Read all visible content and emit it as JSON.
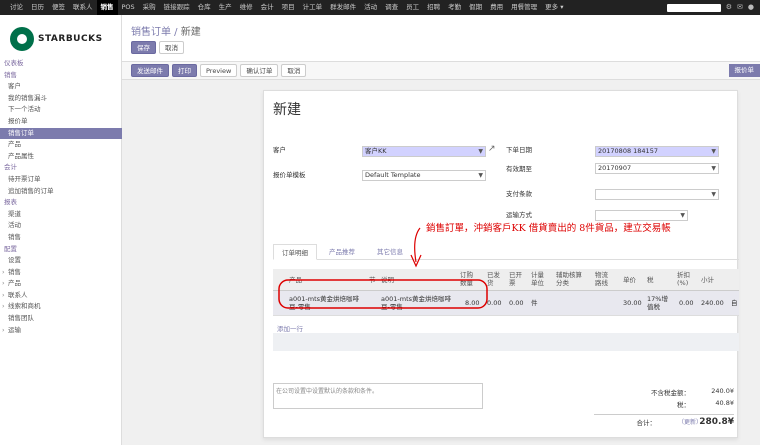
{
  "topbar": {
    "menu": [
      "讨论",
      "日历",
      "便签",
      "联系人",
      "销售",
      "POS",
      "采购",
      "链接跟踪",
      "仓库",
      "生产",
      "维修",
      "会计",
      "项目",
      "计工单",
      "群发邮件",
      "活动",
      "调查",
      "员工",
      "招聘",
      "考勤",
      "假期",
      "费用",
      "用餐管理",
      "更多 ▾"
    ],
    "active_index": 4
  },
  "logo": {
    "text": "STARBUCKS",
    "mark": "starbucks-logo"
  },
  "sidebar": {
    "items": [
      {
        "label": "仪表板",
        "kind": "head"
      },
      {
        "label": "销售",
        "kind": "head"
      },
      {
        "label": "客户",
        "kind": "sub"
      },
      {
        "label": "我的销售漏斗",
        "kind": "sub"
      },
      {
        "label": "下一个活动",
        "kind": "sub"
      },
      {
        "label": "报价单",
        "kind": "sub"
      },
      {
        "label": "销售订单",
        "kind": "active"
      },
      {
        "label": "产品",
        "kind": "sub"
      },
      {
        "label": "产品属性",
        "kind": "sub"
      },
      {
        "label": "会计",
        "kind": "head"
      },
      {
        "label": "待开票订单",
        "kind": "sub"
      },
      {
        "label": "追加销售的订单",
        "kind": "sub"
      },
      {
        "label": "报表",
        "kind": "head"
      },
      {
        "label": "渠道",
        "kind": "sub"
      },
      {
        "label": "活动",
        "kind": "sub"
      },
      {
        "label": "销售",
        "kind": "sub"
      },
      {
        "label": "配置",
        "kind": "head"
      },
      {
        "label": "设置",
        "kind": "sub"
      },
      {
        "label": "销售",
        "kind": "caret"
      },
      {
        "label": "产品",
        "kind": "caret"
      },
      {
        "label": "联系人",
        "kind": "caret"
      },
      {
        "label": "线索和商机",
        "kind": "caret"
      },
      {
        "label": "销售团队",
        "kind": "sub"
      },
      {
        "label": "运输",
        "kind": "caret"
      }
    ]
  },
  "breadcrumb": {
    "parent": "销售订单",
    "sep": " / ",
    "current": "新建"
  },
  "header_buttons": {
    "save": "保存",
    "discard": "取消"
  },
  "status_buttons": {
    "send_email": "发送邮件",
    "print": "打印",
    "preview": "Preview",
    "confirm": "确认订单",
    "cancel": "取消"
  },
  "stage": "报价单",
  "form": {
    "title": "新建",
    "customer_label": "客户",
    "customer_value": "客户KK",
    "template_label": "报价单模板",
    "template_value": "Default Template",
    "order_date_label": "下单日期",
    "order_date_value": "20170808 184157",
    "validity_label": "有效期至",
    "validity_value": "20170907",
    "payment_terms_label": "支付条款",
    "shipping_label": "运输方式"
  },
  "tabs": [
    "订单明细",
    "产品推荐",
    "其它信息"
  ],
  "table": {
    "headers": [
      "产品",
      "节",
      "说明",
      "订购\n数量",
      "已发\n货",
      "已开\n票",
      "计量\n单位",
      "辅助核算\n分类",
      "物流\n路线",
      "单价",
      "税",
      "折扣\n(%)",
      "小计"
    ],
    "row": {
      "product": "a001-mts黄金烘焙咖啡豆-零售",
      "section": "",
      "description": "a001-mts黄金烘焙咖啡豆-零售",
      "qty": "8.00",
      "delivered": "0.00",
      "invoiced": "0.00",
      "uom": "件",
      "analytic": "",
      "route": "",
      "price": "30.00",
      "tax": "17%增值税",
      "discount": "0.00",
      "subtotal": "240.00",
      "trail": "自"
    },
    "add_line": "添加一行"
  },
  "annotation": "銷售訂單，沖銷客戶KK 借貨賣出的 8件貨品，建立交易帳",
  "terms_placeholder": "在公司设置中设置默认的条款和条件。",
  "totals": {
    "untaxed_label": "不含税金额：",
    "untaxed_value": "240.0¥",
    "tax_label": "税：",
    "tax_value": "40.8¥",
    "total_label": "合计：",
    "update_label": "（更新）",
    "total_value": "280.8¥"
  },
  "colors": {
    "brand": "#7c7bad",
    "topbar": "#222222",
    "annotation": "#dd0000",
    "logo_green": "#00704a"
  }
}
